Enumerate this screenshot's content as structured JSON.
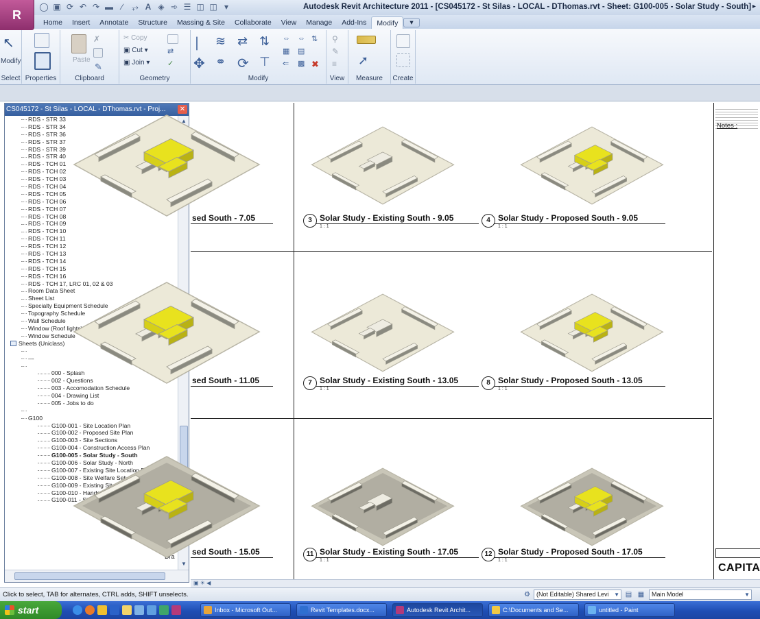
{
  "app": {
    "window_title": "Autodesk Revit Architecture 2011 - [CS045172 - St Silas - LOCAL - DThomas.rvt - Sheet: G100-005 - Solar Study - South]",
    "logo_letter": "R"
  },
  "ribbon": {
    "tabs": [
      "Home",
      "Insert",
      "Annotate",
      "Structure",
      "Massing & Site",
      "Collaborate",
      "View",
      "Manage",
      "Add-Ins",
      "Modify"
    ],
    "active_tab": "Modify",
    "panels": {
      "select": "Select",
      "properties": "Properties",
      "clipboard": "Clipboard",
      "geometry": "Geometry",
      "modify": "Modify",
      "view": "View",
      "measure": "Measure",
      "create": "Create"
    },
    "buttons": {
      "modify": "Modify",
      "paste": "Paste",
      "copy": "Copy",
      "cut": "Cut",
      "join": "Join"
    }
  },
  "browser": {
    "title": "CS045172 - St Silas - LOCAL - DThomas.rvt - Proj...",
    "rows": [
      {
        "text": "RDS - STR 33",
        "indent": 1
      },
      {
        "text": "RDS - STR 34",
        "indent": 1
      },
      {
        "text": "RDS - STR 36",
        "indent": 1
      },
      {
        "text": "RDS - STR 37",
        "indent": 1
      },
      {
        "text": "RDS - STR 39",
        "indent": 1
      },
      {
        "text": "RDS - STR 40",
        "indent": 1
      },
      {
        "text": "RDS - TCH 01",
        "indent": 1
      },
      {
        "text": "RDS - TCH 02",
        "indent": 1
      },
      {
        "text": "RDS - TCH 03",
        "indent": 1
      },
      {
        "text": "RDS - TCH 04",
        "indent": 1
      },
      {
        "text": "RDS - TCH 05",
        "indent": 1
      },
      {
        "text": "RDS - TCH 06",
        "indent": 1
      },
      {
        "text": "RDS - TCH 07",
        "indent": 1
      },
      {
        "text": "RDS - TCH 08",
        "indent": 1
      },
      {
        "text": "RDS - TCH 09",
        "indent": 1
      },
      {
        "text": "RDS - TCH 10",
        "indent": 1
      },
      {
        "text": "RDS - TCH 11",
        "indent": 1
      },
      {
        "text": "RDS - TCH 12",
        "indent": 1
      },
      {
        "text": "RDS - TCH 13",
        "indent": 1
      },
      {
        "text": "RDS - TCH 14",
        "indent": 1
      },
      {
        "text": "RDS - TCH 15",
        "indent": 1
      },
      {
        "text": "RDS - TCH 16",
        "indent": 1
      },
      {
        "text": "RDS - TCH 17, LRC 01, 02 & 03",
        "indent": 1
      },
      {
        "text": "Room Data Sheet",
        "indent": 1
      },
      {
        "text": "Sheet List",
        "indent": 1
      },
      {
        "text": "Specialty Equipment Schedule",
        "indent": 1
      },
      {
        "text": "Topography Schedule",
        "indent": 1
      },
      {
        "text": "Wall Schedule",
        "indent": 1
      },
      {
        "text": "Window (Roof lights) Schedule",
        "indent": 1
      },
      {
        "text": "Window Schedule",
        "indent": 1
      },
      {
        "text": "Sheets (Uniclass)",
        "indent": 0,
        "icon": true
      },
      {
        "text": "",
        "indent": 1
      },
      {
        "text": "---",
        "indent": 1
      },
      {
        "text": "",
        "indent": 1
      },
      {
        "text": "000 - Splash",
        "indent": 2
      },
      {
        "text": "002 - Questions",
        "indent": 2
      },
      {
        "text": "003 - Accomodation Schedule",
        "indent": 2
      },
      {
        "text": "004 - Drawing List",
        "indent": 2
      },
      {
        "text": "005 - Jobs to do",
        "indent": 2
      },
      {
        "text": "",
        "indent": 1
      },
      {
        "text": "G100",
        "indent": 1
      },
      {
        "text": "G100-001 - Site Location Plan",
        "indent": 2
      },
      {
        "text": "G100-002 - Proposed Site Plan",
        "indent": 2
      },
      {
        "text": "G100-003 - Site Sections",
        "indent": 2
      },
      {
        "text": "G100-004 - Construction Access Plan",
        "indent": 2
      },
      {
        "text": "G100-005 - Solar Study - South",
        "indent": 2,
        "bold": true
      },
      {
        "text": "G100-006 - Solar Study - North",
        "indent": 2
      },
      {
        "text": "G100-007 - Existing Site Location Plan",
        "indent": 2
      },
      {
        "text": "G100-008 - Site Welfare Setup",
        "indent": 2
      },
      {
        "text": "G100-009 - Existing Site Plan",
        "indent": 2
      },
      {
        "text": "G100-010 - Handover Conditions",
        "indent": 2
      },
      {
        "text": "G100-011 - Site Plan",
        "indent": 2
      }
    ],
    "side_note": "Dra"
  },
  "sheet": {
    "views": [
      {
        "num": "",
        "title": "sed South - 7.05",
        "scale": "",
        "proposed": true
      },
      {
        "num": "3",
        "title": "Solar Study - Existing South - 9.05",
        "scale": "1 : 1",
        "proposed": false
      },
      {
        "num": "4",
        "title": "Solar Study - Proposed South - 9.05",
        "scale": "1 : 1",
        "proposed": true
      },
      {
        "num": "",
        "title": "sed South - 11.05",
        "scale": "",
        "proposed": true
      },
      {
        "num": "7",
        "title": "Solar Study - Existing South - 13.05",
        "scale": "1 : 1",
        "proposed": false
      },
      {
        "num": "8",
        "title": "Solar Study - Proposed South - 13.05",
        "scale": "1 : 1",
        "proposed": true
      },
      {
        "num": "",
        "title": "sed South - 15.05",
        "scale": "",
        "proposed": true
      },
      {
        "num": "11",
        "title": "Solar Study - Existing South - 17.05",
        "scale": "1 : 1",
        "proposed": false
      },
      {
        "num": "12",
        "title": "Solar Study - Proposed South - 17.05",
        "scale": "1 : 1",
        "proposed": true
      }
    ],
    "title_block": {
      "notes_label": "Notes :",
      "company": "CAPITA"
    }
  },
  "status": {
    "hint": "Click to select, TAB for alternates, CTRL adds, SHIFT unselects.",
    "workset": "(Not Editable) Shared Levi",
    "model": "Main Model"
  },
  "taskbar": {
    "start": "start",
    "items": [
      {
        "label": "Inbox - Microsoft Out...",
        "color": "#e8a53a"
      },
      {
        "label": "Revit Templates.docx...",
        "color": "#2f6fd0"
      },
      {
        "label": "Autodesk Revit Archit...",
        "color": "#b33a7a",
        "active": true
      },
      {
        "label": "C:\\Documents and Se...",
        "color": "#f1c844"
      },
      {
        "label": "untitled - Paint",
        "color": "#6bb2f0"
      }
    ]
  },
  "colors": {
    "proposed_building": "#e8e21e",
    "site_base": "#ece9d8",
    "shadow": "#8a8a80"
  }
}
